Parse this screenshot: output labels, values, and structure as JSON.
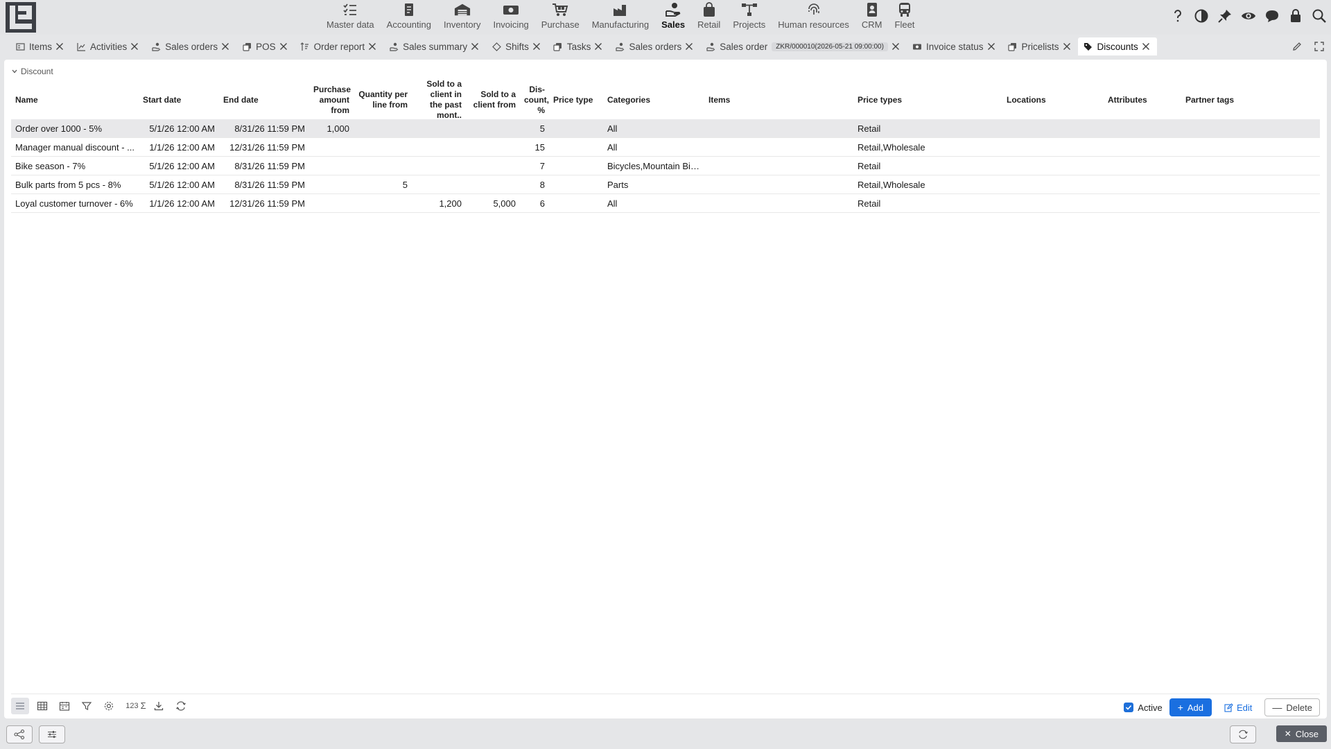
{
  "colors": {
    "accent": "#1a6fe0",
    "selected_row": "#e8e8ea",
    "close_button": "#5a5e66"
  },
  "nav": {
    "modules": [
      {
        "label": "Master data",
        "icon": "checklist-icon"
      },
      {
        "label": "Accounting",
        "icon": "ledger-icon"
      },
      {
        "label": "Inventory",
        "icon": "warehouse-icon"
      },
      {
        "label": "Invoicing",
        "icon": "banknote-icon"
      },
      {
        "label": "Purchase",
        "icon": "cart-icon"
      },
      {
        "label": "Manufacturing",
        "icon": "factory-icon"
      },
      {
        "label": "Sales",
        "icon": "hand-coin-icon",
        "active": true
      },
      {
        "label": "Retail",
        "icon": "shopping-bag-icon"
      },
      {
        "label": "Projects",
        "icon": "project-tree-icon"
      },
      {
        "label": "Human resources",
        "icon": "fingerprint-icon"
      },
      {
        "label": "CRM",
        "icon": "contact-card-icon"
      },
      {
        "label": "Fleet",
        "icon": "bus-icon"
      }
    ],
    "right_icons": [
      "help-icon",
      "contrast-icon",
      "pin-icon",
      "eye-icon",
      "chat-icon",
      "lock-icon",
      "search-icon"
    ]
  },
  "tabs": [
    {
      "label": "Items"
    },
    {
      "label": "Activities"
    },
    {
      "label": "Sales orders"
    },
    {
      "label": "POS"
    },
    {
      "label": "Order report"
    },
    {
      "label": "Sales summary"
    },
    {
      "label": "Shifts"
    },
    {
      "label": "Tasks"
    },
    {
      "label": "Sales orders"
    },
    {
      "label": "Sales order",
      "badge": "ZKR/000010(2026-05-21 09:00:00)"
    },
    {
      "label": "Invoice status"
    },
    {
      "label": "Pricelists"
    },
    {
      "label": "Discounts",
      "active": true
    }
  ],
  "section": {
    "title": "Discount"
  },
  "table": {
    "columns": {
      "name": "Name",
      "start": "Start date",
      "end": "End date",
      "amount": "Purchase amount from",
      "qty": "Quantity per line from",
      "past": "Sold to a client in the past mont..",
      "client": "Sold to a client from",
      "disc": "Dis-count, %",
      "ptype": "Price type",
      "cat": "Categories",
      "items": "Items",
      "ptypes": "Price types",
      "loc": "Locations",
      "attr": "Attributes",
      "tags": "Partner tags"
    },
    "rows": [
      {
        "name": "Order over 1000 - 5%",
        "start": "5/1/26 12:00 AM",
        "end": "8/31/26 11:59 PM",
        "amount": "1,000",
        "qty": "",
        "past": "",
        "client": "",
        "disc": "5",
        "ptype": "",
        "cat": "All",
        "items": "",
        "ptypes": "Retail",
        "loc": "",
        "attr": "",
        "tags": "",
        "selected": true
      },
      {
        "name": "Manager manual discount - ...",
        "start": "1/1/26 12:00 AM",
        "end": "12/31/26 11:59 PM",
        "amount": "",
        "qty": "",
        "past": "",
        "client": "",
        "disc": "15",
        "ptype": "",
        "cat": "All",
        "items": "",
        "ptypes": "Retail,Wholesale",
        "loc": "",
        "attr": "",
        "tags": ""
      },
      {
        "name": "Bike season - 7%",
        "start": "5/1/26 12:00 AM",
        "end": "8/31/26 11:59 PM",
        "amount": "",
        "qty": "",
        "past": "",
        "client": "",
        "disc": "7",
        "ptype": "",
        "cat": "Bicycles,Mountain Bikes",
        "items": "",
        "ptypes": "Retail",
        "loc": "",
        "attr": "",
        "tags": ""
      },
      {
        "name": "Bulk parts from 5 pcs - 8%",
        "start": "5/1/26 12:00 AM",
        "end": "8/31/26 11:59 PM",
        "amount": "",
        "qty": "5",
        "past": "",
        "client": "",
        "disc": "8",
        "ptype": "",
        "cat": "Parts",
        "items": "",
        "ptypes": "Retail,Wholesale",
        "loc": "",
        "attr": "",
        "tags": ""
      },
      {
        "name": "Loyal customer turnover - 6%",
        "start": "1/1/26 12:00 AM",
        "end": "12/31/26 11:59 PM",
        "amount": "",
        "qty": "",
        "past": "1,200",
        "client": "5,000",
        "disc": "6",
        "ptype": "",
        "cat": "All",
        "items": "",
        "ptypes": "Retail",
        "loc": "",
        "attr": "",
        "tags": ""
      }
    ]
  },
  "toolbar": {
    "summary_label": "123",
    "active_label": "Active",
    "active_checked": true,
    "add_label": "Add",
    "edit_label": "Edit",
    "delete_label": "Delete"
  },
  "footer": {
    "close_label": "Close"
  }
}
